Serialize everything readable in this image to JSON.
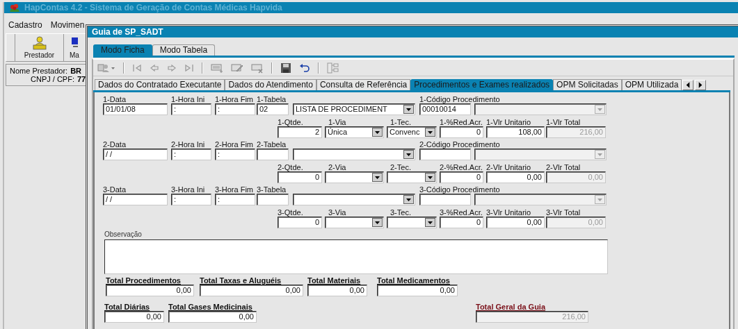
{
  "main_window": {
    "title": "HapContas 4.2 - Sistema de Geração de Contas Médicas Hapvida",
    "menu": [
      "Cadastro",
      "Movimen"
    ],
    "toolbar": [
      "Prestador",
      "Ma"
    ],
    "provider": [
      {
        "label": "Nome Prestador:",
        "value": "BR"
      },
      {
        "label": "CNPJ / CPF:",
        "value": "77"
      }
    ]
  },
  "dialog": {
    "title": "Guia de SP_SADT",
    "mode_tabs": [
      {
        "label": "Modo Ficha",
        "selected": true
      },
      {
        "label": "Modo Tabela",
        "selected": false
      }
    ],
    "section_tabs": [
      {
        "label": "Dados do Contratado Executante",
        "selected": false
      },
      {
        "label": "Dados do Atendimento",
        "selected": false
      },
      {
        "label": "Consulta de Referência",
        "selected": false
      },
      {
        "label": "Procedimentos e Exames realizados",
        "selected": true
      },
      {
        "label": "OPM Solicitadas",
        "selected": false
      },
      {
        "label": "OPM Utilizada",
        "selected": false
      }
    ],
    "procedures": [
      {
        "fields": [
          {
            "kind": "text",
            "label": "1-Data",
            "value": "01/01/08",
            "disabled": false
          },
          {
            "kind": "text",
            "label": "1-Hora Ini",
            "value": ":",
            "disabled": false
          },
          {
            "kind": "text",
            "label": "1-Hora Fim",
            "value": ":",
            "disabled": false
          },
          {
            "kind": "text",
            "label": "1-Tabela",
            "value": "02",
            "disabled": false
          },
          {
            "kind": "combo",
            "value": "LISTA DE PROCEDIMENT",
            "disabled": false
          },
          {
            "kind": "text",
            "label": "1-Código Procedimento",
            "value": "00010014",
            "disabled": false
          },
          {
            "kind": "combo",
            "disabled": true
          },
          {
            "kind": "number",
            "label": "1-Qtde.",
            "value": "2",
            "disabled": false
          },
          {
            "kind": "combo",
            "label": "1-Via",
            "value": "Única",
            "disabled": false
          },
          {
            "kind": "combo",
            "label": "1-Tec.",
            "value": "Convenc",
            "disabled": false
          },
          {
            "kind": "number",
            "label": "1-%Red.Acr.",
            "value": "0",
            "disabled": false
          },
          {
            "kind": "number",
            "label": "1-Vlr Unitario",
            "value": "108,00",
            "disabled": false
          },
          {
            "kind": "number",
            "label": "1-Vlr Total",
            "value": "216,00",
            "disabled": true
          }
        ]
      },
      {
        "fields": [
          {
            "kind": "text",
            "label": "2-Data",
            "value": "/ /",
            "disabled": false
          },
          {
            "kind": "text",
            "label": "2-Hora Ini",
            "value": ":",
            "disabled": false
          },
          {
            "kind": "text",
            "label": "2-Hora Fim",
            "value": ":",
            "disabled": false
          },
          {
            "kind": "text",
            "label": "2-Tabela",
            "disabled": false
          },
          {
            "kind": "combo",
            "disabled": false
          },
          {
            "kind": "text",
            "label": "2-Código Procedimento",
            "disabled": false
          },
          {
            "kind": "combo",
            "disabled": true
          },
          {
            "kind": "number",
            "label": "2-Qtde.",
            "value": "0",
            "disabled": false
          },
          {
            "kind": "combo",
            "label": "2-Via",
            "disabled": false
          },
          {
            "kind": "combo",
            "label": "2-Tec.",
            "disabled": false
          },
          {
            "kind": "number",
            "label": "2-%Red.Acr.",
            "value": "0",
            "disabled": false
          },
          {
            "kind": "number",
            "label": "2-Vlr Unitario",
            "value": "0,00",
            "disabled": false
          },
          {
            "kind": "number",
            "label": "2-Vlr Total",
            "value": "0,00",
            "disabled": true
          }
        ]
      },
      {
        "fields": [
          {
            "kind": "text",
            "label": "3-Data",
            "value": "/ /",
            "disabled": false
          },
          {
            "kind": "text",
            "label": "3-Hora Ini",
            "value": ":",
            "disabled": false
          },
          {
            "kind": "text",
            "label": "3-Hora Fim",
            "value": ":",
            "disabled": false
          },
          {
            "kind": "text",
            "label": "3-Tabela",
            "disabled": false
          },
          {
            "kind": "combo",
            "disabled": false
          },
          {
            "kind": "text",
            "label": "3-Código Procedimento",
            "disabled": false
          },
          {
            "kind": "combo",
            "disabled": true
          },
          {
            "kind": "number",
            "label": "3-Qtde.",
            "value": "0",
            "disabled": false
          },
          {
            "kind": "combo",
            "label": "3-Via",
            "disabled": false
          },
          {
            "kind": "combo",
            "label": "3-Tec.",
            "disabled": false
          },
          {
            "kind": "number",
            "label": "3-%Red.Acr.",
            "value": "0",
            "disabled": false
          },
          {
            "kind": "number",
            "label": "3-Vlr Unitario",
            "value": "0,00",
            "disabled": false
          },
          {
            "kind": "number",
            "label": "3-Vlr Total",
            "value": "0,00",
            "disabled": true
          }
        ]
      }
    ],
    "observacao": {
      "label": "Observação"
    },
    "totals": [
      {
        "label": "Total Procedimentos",
        "value": "0,00"
      },
      {
        "label": "Total Taxas e Aluguéis",
        "value": "0,00"
      },
      {
        "label": "Total Materiais",
        "value": "0,00"
      },
      {
        "label": "Total Medicamentos",
        "value": "0,00"
      },
      {
        "label": "Total Diárias",
        "value": "0,00"
      },
      {
        "label": "Total Gases Medicinais",
        "value": "0,00"
      }
    ],
    "total_geral": {
      "label": "Total Geral da Guia",
      "value": "216,00",
      "disabled": true
    }
  }
}
